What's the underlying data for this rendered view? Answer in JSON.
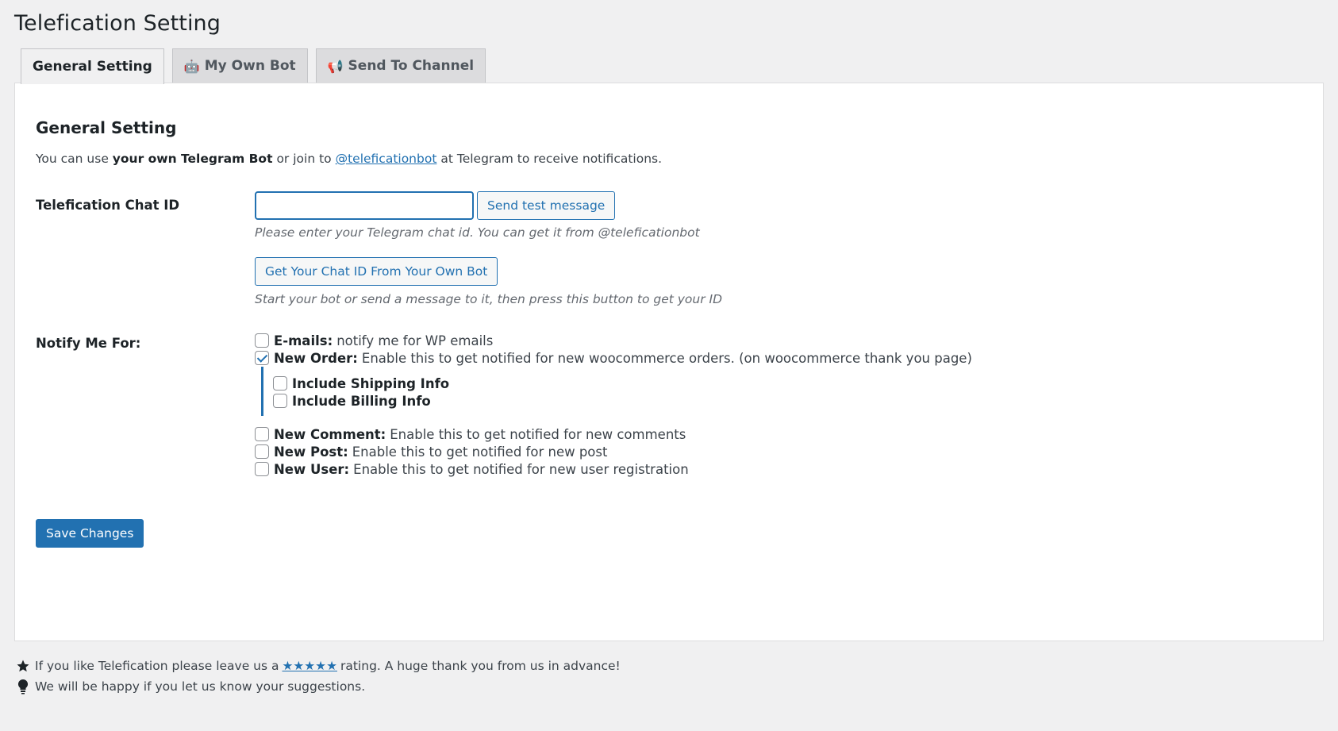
{
  "page": {
    "title": "Telefication Setting"
  },
  "tabs": [
    {
      "label": "General Setting",
      "icon": ""
    },
    {
      "label": "My Own Bot",
      "icon": "🤖"
    },
    {
      "label": "Send To Channel",
      "icon": "📢"
    }
  ],
  "general": {
    "heading": "General Setting",
    "intro": {
      "prefix": "You can use",
      "bold": "your own Telegram Bot",
      "middle": "or join to",
      "link": "@teleficationbot",
      "suffix": "at Telegram to receive notifications."
    },
    "chat_id": {
      "label": "Telefication Chat ID",
      "value": "",
      "test_button": "Send test message",
      "description": "Please enter your Telegram chat id. You can get it from @teleficationbot",
      "get_id_button": "Get Your Chat ID From Your Own Bot",
      "get_id_description": "Start your bot or send a message to it, then press this button to get your ID"
    },
    "notify": {
      "label": "Notify Me For:",
      "options": [
        {
          "title": "E-mails:",
          "text": "notify me for WP emails",
          "checked": false
        },
        {
          "title": "New Order:",
          "text": "Enable this to get notified for new woocommerce orders. (on woocommerce thank you page)",
          "checked": true
        }
      ],
      "order_sub_options": [
        {
          "title": "Include Shipping Info",
          "checked": false
        },
        {
          "title": "Include Billing Info",
          "checked": false
        }
      ],
      "more_options": [
        {
          "title": "New Comment:",
          "text": "Enable this to get notified for new comments",
          "checked": false
        },
        {
          "title": "New Post:",
          "text": "Enable this to get notified for new post",
          "checked": false
        },
        {
          "title": "New User:",
          "text": "Enable this to get notified for new user registration",
          "checked": false
        }
      ]
    },
    "save_button": "Save Changes"
  },
  "footer": {
    "rating": {
      "prefix": "If you like Telefication please leave us a",
      "stars": "★★★★★",
      "suffix": "rating. A huge thank you from us in advance!"
    },
    "suggest": "We will be happy if you let us know your suggestions."
  },
  "colors": {
    "accent": "#2271b1",
    "background": "#f0f0f1"
  }
}
